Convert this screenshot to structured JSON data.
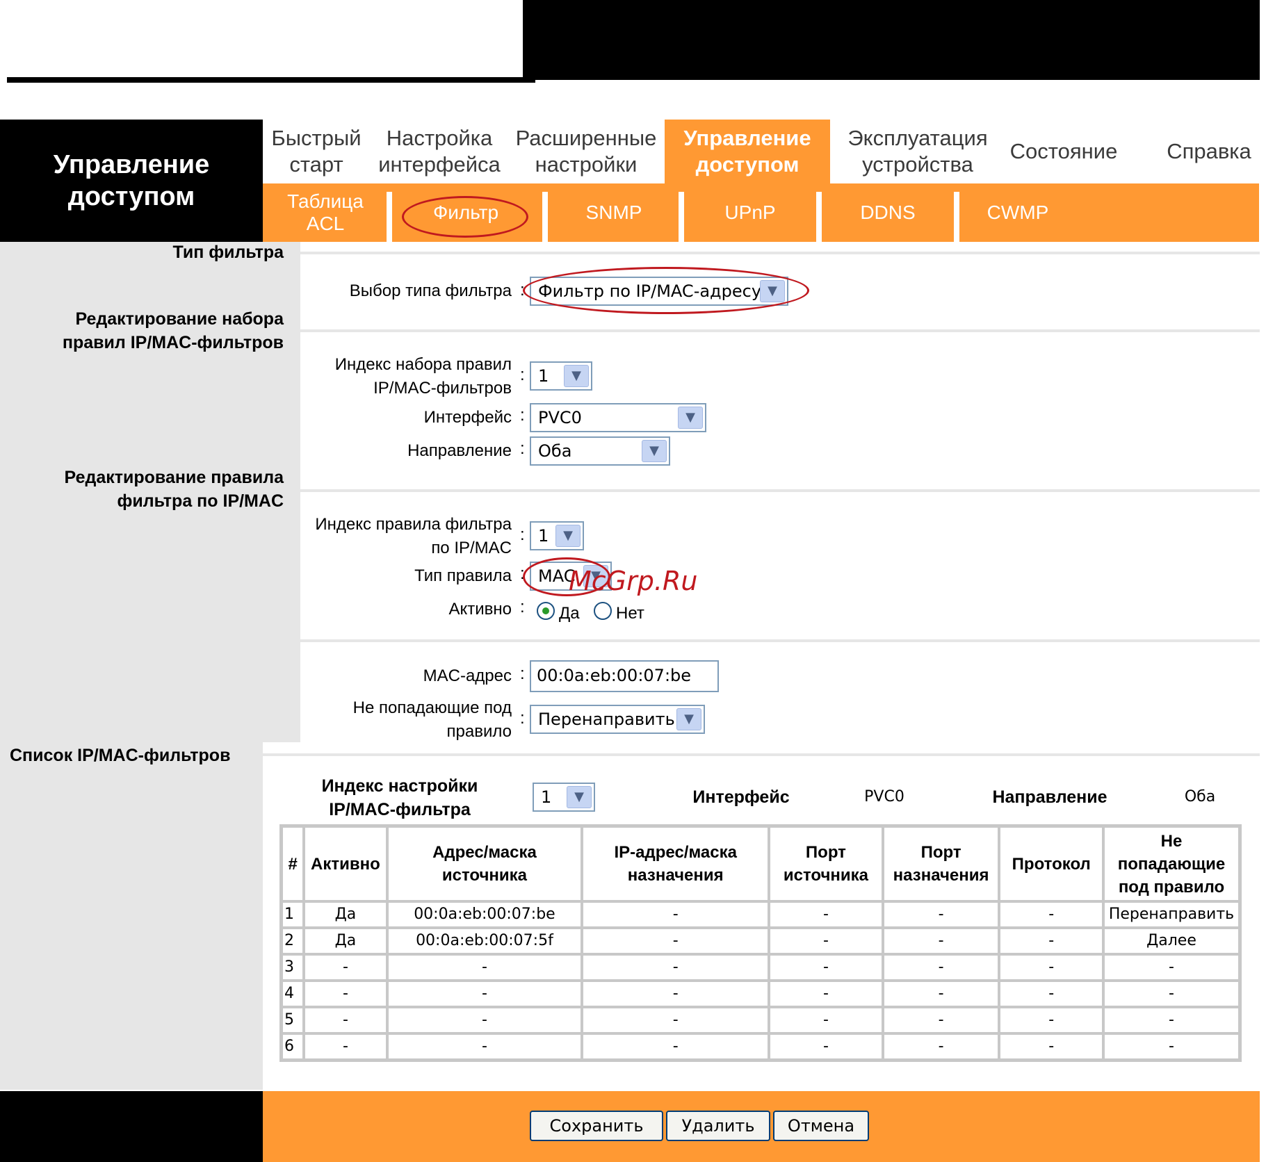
{
  "header": {
    "section_title": "Управление доступом"
  },
  "main_tabs": [
    {
      "label": "Быстрый старт"
    },
    {
      "label": "Настройка интерфейса"
    },
    {
      "label": "Расширенные настройки"
    },
    {
      "label": "Управление доступом"
    },
    {
      "label": "Эксплуатация устройства"
    },
    {
      "label": "Состояние"
    },
    {
      "label": "Справка"
    }
  ],
  "sub_tabs": [
    {
      "label": "Таблица ACL"
    },
    {
      "label": "Фильтр"
    },
    {
      "label": "SNMP"
    },
    {
      "label": "UPnP"
    },
    {
      "label": "DDNS"
    },
    {
      "label": "CWMP"
    }
  ],
  "sections": {
    "filter_type": "Тип фильтра",
    "ruleset_edit": "Редактирование набора правил IP/MAC-фильтров",
    "rule_edit": "Редактирование правила фильтра по IP/MAC",
    "filter_list": "Список IP/MAC-фильтров"
  },
  "form": {
    "filter_type_label": "Выбор типа фильтра",
    "filter_type_value": "Фильтр по IP/MAC-адресу",
    "ruleset_index_label": "Индекс набора правил IP/MAC-фильтров",
    "ruleset_index_value": "1",
    "interface_label": "Интерфейс",
    "interface_value": "PVC0",
    "direction_label": "Направление",
    "direction_value": "Оба",
    "rule_index_label": "Индекс правила фильтра по IP/MAC",
    "rule_index_value": "1",
    "rule_type_label": "Тип правила",
    "rule_type_value": "MAC",
    "active_label": "Активно",
    "active_yes": "Да",
    "active_no": "Нет",
    "mac_label": "MAC-адрес",
    "mac_value": "00:0a:eb:00:07:be",
    "unmatched_label": "Не попадающие под правило",
    "unmatched_value": "Перенаправить",
    "colon": ":"
  },
  "list": {
    "index_label": "Индекс настройки IP/MAC-фильтра",
    "index_value": "1",
    "interface_label": "Интерфейс",
    "interface_value": "PVC0",
    "direction_label": "Направление",
    "direction_value": "Оба",
    "columns": [
      "#",
      "Активно",
      "Адрес/маска источника",
      "IP-адрес/маска назначения",
      "Порт источника",
      "Порт назначения",
      "Протокол",
      "Не попадающие под правило"
    ],
    "rows": [
      [
        "1",
        "Да",
        "00:0a:eb:00:07:be",
        "-",
        "-",
        "-",
        "-",
        "Перенаправить"
      ],
      [
        "2",
        "Да",
        "00:0a:eb:00:07:5f",
        "-",
        "-",
        "-",
        "-",
        "Далее"
      ],
      [
        "3",
        "-",
        "-",
        "-",
        "-",
        "-",
        "-",
        "-"
      ],
      [
        "4",
        "-",
        "-",
        "-",
        "-",
        "-",
        "-",
        "-"
      ],
      [
        "5",
        "-",
        "-",
        "-",
        "-",
        "-",
        "-",
        "-"
      ],
      [
        "6",
        "-",
        "-",
        "-",
        "-",
        "-",
        "-",
        "-"
      ]
    ]
  },
  "buttons": {
    "save": "Сохранить",
    "delete": "Удалить",
    "cancel": "Отмена"
  },
  "watermark": "McGrp.Ru",
  "colors": {
    "accent_orange": "#ff9933",
    "annotation_red": "#c0191f",
    "panel_grey": "#e6e6e6"
  }
}
